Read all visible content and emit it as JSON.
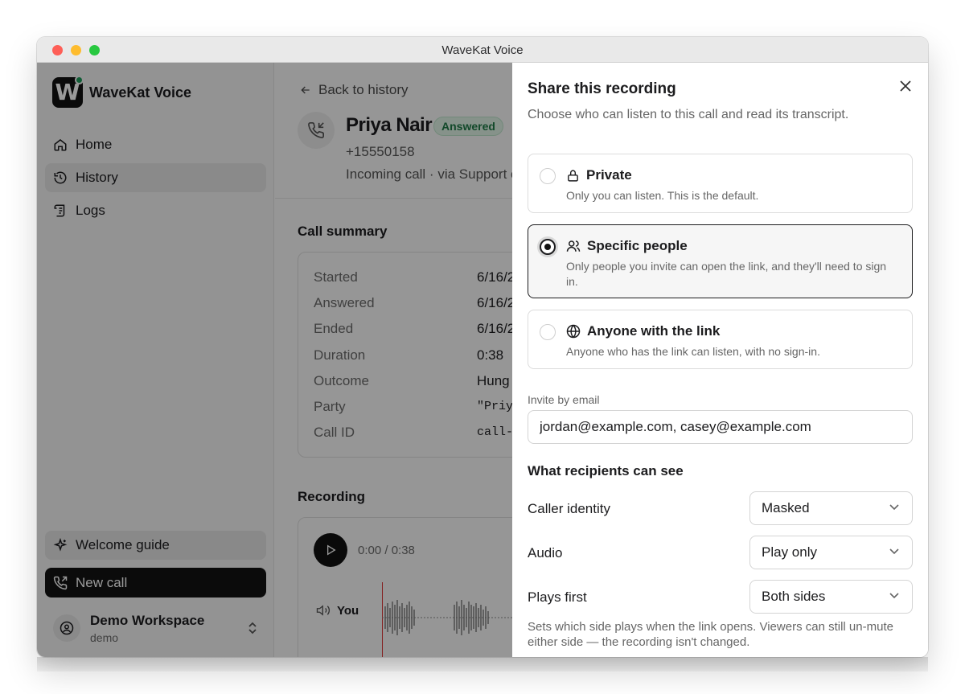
{
  "window": {
    "title": "WaveKat Voice"
  },
  "sidebar": {
    "brand": "WaveKat Voice",
    "logo_letter": "W",
    "items": [
      {
        "label": "Home",
        "icon": "home-icon"
      },
      {
        "label": "History",
        "icon": "history-icon",
        "active": true
      },
      {
        "label": "Logs",
        "icon": "logs-icon"
      }
    ],
    "welcome_label": "Welcome guide",
    "new_call_label": "New call",
    "workspace": {
      "name": "Demo Workspace",
      "sub": "demo"
    }
  },
  "main": {
    "back_label": "Back to history",
    "caller": {
      "name": "Priya Nair",
      "status": "Answered",
      "phone": "+15550158",
      "meta": "Incoming call · via Support c"
    },
    "summary_title": "Call summary",
    "summary": [
      {
        "label": "Started",
        "value": "6/16/2"
      },
      {
        "label": "Answered",
        "value": "6/16/2"
      },
      {
        "label": "Ended",
        "value": "6/16/2"
      },
      {
        "label": "Duration",
        "value": "0:38"
      },
      {
        "label": "Outcome",
        "value": "Hung"
      },
      {
        "label": "Party",
        "value": "\"Priya"
      },
      {
        "label": "Call ID",
        "value": "call-c"
      }
    ],
    "recording_title": "Recording",
    "time": "0:00 / 0:38",
    "track_label": "You"
  },
  "share": {
    "title": "Share this recording",
    "subtitle": "Choose who can listen to this call and read its transcript.",
    "options": [
      {
        "title": "Private",
        "desc": "Only you can listen. This is the default.",
        "icon": "lock-icon",
        "selected": false
      },
      {
        "title": "Specific people",
        "desc": "Only people you invite can open the link, and they'll need to sign in.",
        "icon": "people-icon",
        "selected": true
      },
      {
        "title": "Anyone with the link",
        "desc": "Anyone who has the link can listen, with no sign-in.",
        "icon": "globe-icon",
        "selected": false
      }
    ],
    "invite_label": "Invite by email",
    "invite_value": "jordan@example.com, casey@example.com",
    "recipients_title": "What recipients can see",
    "settings": [
      {
        "label": "Caller identity",
        "value": "Masked"
      },
      {
        "label": "Audio",
        "value": "Play only"
      },
      {
        "label": "Plays first",
        "value": "Both sides"
      }
    ],
    "help": "Sets which side plays when the link opens. Viewers can still un-mute either side — the recording isn't changed."
  }
}
